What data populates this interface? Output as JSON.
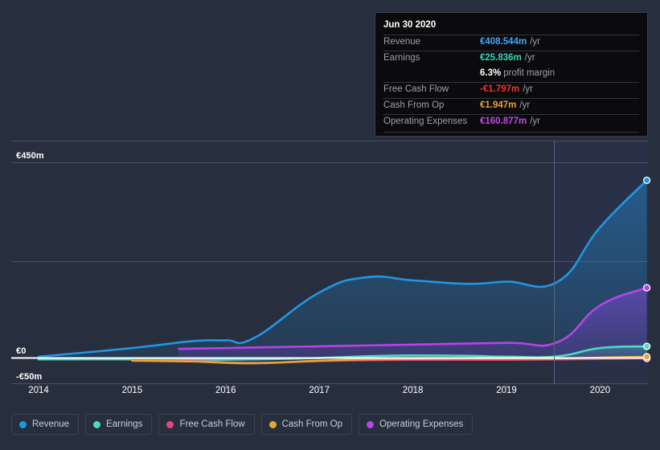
{
  "chart_data": {
    "type": "area",
    "title": "",
    "xlabel": "",
    "ylabel": "",
    "currency": "EUR",
    "units": "millions",
    "xticks": [
      "2014",
      "2015",
      "2016",
      "2017",
      "2018",
      "2019",
      "2020"
    ],
    "yticks": [
      "€450m",
      "€0",
      "-€50m"
    ],
    "ylim": [
      -50,
      470
    ],
    "grid": true,
    "legend_position": "bottom",
    "forecast_divider_x_year": 2019.55,
    "series": [
      {
        "name": "Revenue",
        "color": "#2196e3",
        "x": [
          2014.0,
          2015.0,
          2015.65,
          2016.0,
          2016.3,
          2017.0,
          2017.5,
          2018.0,
          2018.6,
          2019.0,
          2019.55,
          2020.0,
          2020.5
        ],
        "values": [
          2,
          22,
          38,
          40,
          45,
          150,
          185,
          178,
          170,
          175,
          175,
          300,
          408.544
        ]
      },
      {
        "name": "Earnings",
        "color": "#4fd8c4",
        "x": [
          2014.0,
          2015.0,
          2015.65,
          2016.3,
          2017.0,
          2017.5,
          2018.0,
          2018.6,
          2019.0,
          2019.55,
          2020.0,
          2020.5
        ],
        "values": [
          -4,
          -4,
          -5,
          -4,
          -1,
          3,
          5,
          4,
          2,
          3,
          22,
          25.836
        ]
      },
      {
        "name": "Free Cash Flow",
        "color": "#e0477d",
        "x": [
          2015.0,
          2015.65,
          2016.3,
          2017.0,
          2017.5,
          2018.0,
          2018.6,
          2019.0,
          2019.55,
          2020.0,
          2020.5
        ],
        "values": [
          -6,
          -8,
          -12,
          -8,
          -6,
          -5,
          -5,
          -5,
          -4,
          -3,
          -1.797
        ]
      },
      {
        "name": "Cash From Op",
        "color": "#e8a33d",
        "x": [
          2015.0,
          2015.65,
          2016.3,
          2017.0,
          2017.5,
          2018.0,
          2018.6,
          2019.0,
          2019.55,
          2020.0,
          2020.5
        ],
        "values": [
          -7,
          -9,
          -13,
          -7,
          -4,
          -3,
          -2,
          -2,
          -2,
          0,
          1.947
        ]
      },
      {
        "name": "Operating Expenses",
        "color": "#b545e8",
        "x": [
          2015.5,
          2016.0,
          2017.0,
          2018.0,
          2019.0,
          2019.55,
          2020.0,
          2020.5
        ],
        "values": [
          20,
          22,
          26,
          30,
          34,
          36,
          120,
          160.877
        ]
      }
    ]
  },
  "axis": {
    "y_labels": [
      {
        "text": "€450m",
        "value": 450
      },
      {
        "text": "€0",
        "value": 0
      },
      {
        "text": "-€50m",
        "value": -50
      }
    ],
    "x_labels": [
      "2014",
      "2015",
      "2016",
      "2017",
      "2018",
      "2019",
      "2020"
    ]
  },
  "tooltip": {
    "date": "Jun 30 2020",
    "rows": [
      {
        "label": "Revenue",
        "value": "€408.544m",
        "unit": "/yr",
        "color": "#3fa9f5"
      },
      {
        "label": "Earnings",
        "value": "€25.836m",
        "unit": "/yr",
        "color": "#2fd8b8"
      },
      {
        "label": "",
        "value": "6.3%",
        "sub": "profit margin",
        "color": "#ffffff"
      },
      {
        "label": "Free Cash Flow",
        "value": "-€1.797m",
        "unit": "/yr",
        "color": "#e8362c"
      },
      {
        "label": "Cash From Op",
        "value": "€1.947m",
        "unit": "/yr",
        "color": "#e8a33d"
      },
      {
        "label": "Operating Expenses",
        "value": "€160.877m",
        "unit": "/yr",
        "color": "#c44ae8"
      }
    ]
  },
  "legend": {
    "items": [
      {
        "label": "Revenue",
        "color": "#2196e3"
      },
      {
        "label": "Earnings",
        "color": "#4fd8c4"
      },
      {
        "label": "Free Cash Flow",
        "color": "#e0477d"
      },
      {
        "label": "Cash From Op",
        "color": "#e8a33d"
      },
      {
        "label": "Operating Expenses",
        "color": "#b545e8"
      }
    ]
  }
}
